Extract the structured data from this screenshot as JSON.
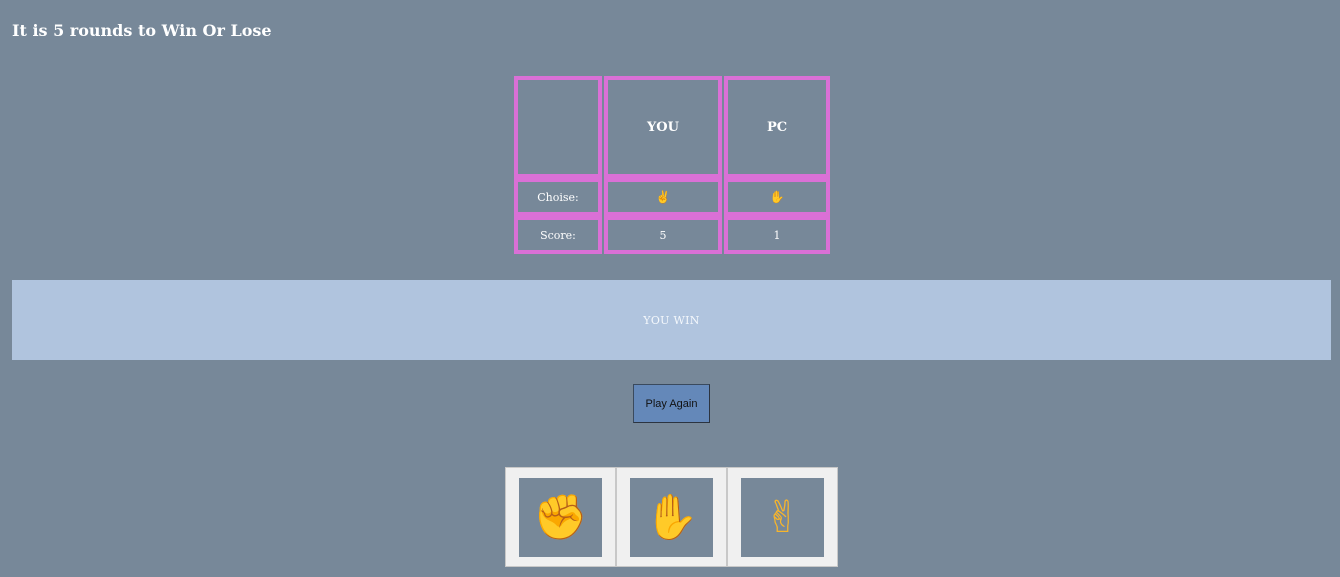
{
  "header": {
    "title": "It is 5 rounds to Win Or Lose"
  },
  "scoreboard": {
    "columns": {
      "you": "YOU",
      "pc": "PC"
    },
    "choice_label": "Choise:",
    "score_label": "Score:",
    "you_choice_icon": "✌",
    "pc_choice_icon": "✋",
    "you_choice_name": "victory-hand-icon",
    "pc_choice_name": "raised-hand-icon",
    "you_score": "5",
    "pc_score": "1"
  },
  "result": {
    "message": "YOU WIN"
  },
  "controls": {
    "play_again_label": "Play Again"
  },
  "choices": [
    {
      "name": "rock",
      "icon": "✊",
      "icon_name": "raised-fist-icon"
    },
    {
      "name": "paper",
      "icon": "✋",
      "icon_name": "raised-hand-icon"
    },
    {
      "name": "scissors",
      "icon": "✌",
      "icon_name": "victory-hand-icon"
    }
  ],
  "colors": {
    "background": "#778899",
    "table_border": "#da70d6",
    "result_banner": "#b0c4de",
    "play_again_button": "#6488b9",
    "choice_frame": "#f0f0f0",
    "hand_icon": "#f7b52c"
  }
}
